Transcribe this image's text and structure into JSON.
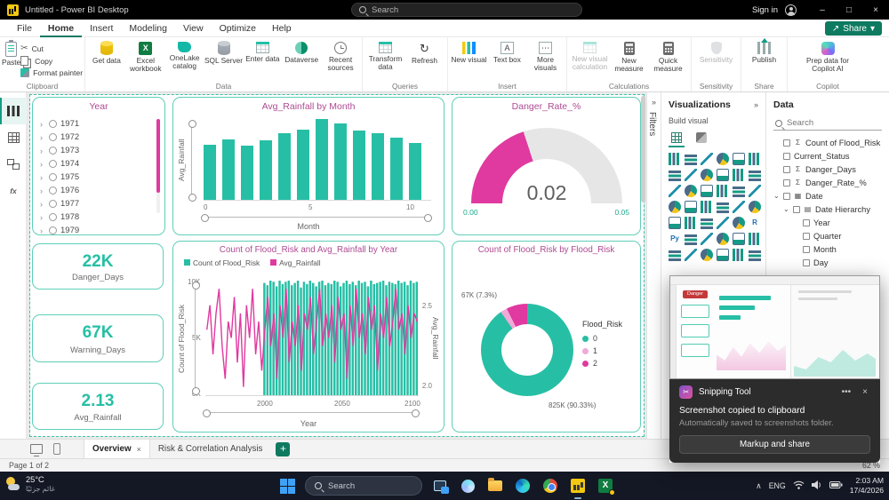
{
  "icons": {
    "minimize": "–",
    "maximize": "□",
    "close": "×",
    "share_arrow": "↗",
    "caret_down": "▾",
    "chevron_right": "›",
    "chevron_down": "⌄",
    "collapse_double": "»",
    "more": "•••",
    "plus": "+",
    "cut_glyph": "✂",
    "refresh_glyph": "↻",
    "tray_chevron": "∧",
    "text_a": "A",
    "dots": "⋯"
  },
  "colors": {
    "teal": "#26BFA5",
    "teal_dark": "#159B84",
    "pink": "#E0399F",
    "pink_light": "#F2A9D8",
    "title_pink": "#AF4B93"
  },
  "titlebar": {
    "app_title": "Untitled - Power BI Desktop",
    "search_placeholder": "Search",
    "sign_in": "Sign in"
  },
  "menubar": {
    "items": [
      "File",
      "Home",
      "Insert",
      "Modeling",
      "View",
      "Optimize",
      "Help"
    ],
    "share": "Share"
  },
  "ribbon": {
    "clipboard": {
      "label": "Clipboard",
      "paste": "Paste",
      "cut": "Cut",
      "copy": "Copy",
      "format_painter": "Format painter"
    },
    "data": {
      "label": "Data",
      "buttons": [
        "Get data",
        "Excel workbook",
        "OneLake catalog",
        "SQL Server",
        "Enter data",
        "Dataverse",
        "Recent sources"
      ]
    },
    "queries": {
      "label": "Queries",
      "buttons": [
        "Transform data",
        "Refresh"
      ]
    },
    "insert": {
      "label": "Insert",
      "buttons": [
        "New visual",
        "Text box",
        "More visuals"
      ]
    },
    "calculations": {
      "label": "Calculations",
      "buttons": [
        "New visual calculation",
        "New measure",
        "Quick measure"
      ]
    },
    "sensitivity": {
      "label": "Sensitivity",
      "buttons": [
        "Sensitivity"
      ]
    },
    "share_group": {
      "label": "Share",
      "buttons": [
        "Publish"
      ]
    },
    "copilot": {
      "label": "Copilot",
      "buttons": [
        "Prep data for Copilot AI"
      ]
    }
  },
  "canvas": {
    "slicer": {
      "title": "Year",
      "years": [
        "1971",
        "1972",
        "1973",
        "1974",
        "1975",
        "1976",
        "1977",
        "1978",
        "1979"
      ]
    },
    "bar_chart": {
      "type": "bar",
      "title": "Avg_Rainfall by Month",
      "y_label": "Avg_Rainfall",
      "x_label": "Month",
      "x_ticks": [
        "0",
        "5",
        "10"
      ],
      "months": [
        1,
        2,
        3,
        4,
        5,
        6,
        7,
        8,
        9,
        10,
        11,
        12
      ],
      "values": [
        1.75,
        1.9,
        1.72,
        1.88,
        2.1,
        2.2,
        2.55,
        2.4,
        2.18,
        2.1,
        1.95,
        1.8
      ]
    },
    "gauge": {
      "type": "gauge",
      "title": "Danger_Rate_%",
      "value": "0.02",
      "min": "0.00",
      "max": "0.05"
    },
    "cards": [
      {
        "value": "22K",
        "label": "Danger_Days"
      },
      {
        "value": "67K",
        "label": "Warning_Days"
      },
      {
        "value": "2.13",
        "label": "Avg_Rainfall"
      }
    ],
    "combo": {
      "type": "line-and-column",
      "title": "Count of Flood_Risk and Avg_Rainfall by Year",
      "legend": [
        "Count of Flood_Risk",
        "Avg_Rainfall"
      ],
      "y_left_label": "Count of Flood_Risk",
      "y_left_ticks": [
        "10K",
        "5K",
        "0K"
      ],
      "y_right_label": "Avg_Rainfall",
      "y_right_ticks": [
        "2.5",
        "2.0"
      ],
      "x_label": "Year",
      "x_ticks": [
        "2000",
        "2050",
        "2100"
      ],
      "year_start": 1962,
      "year_step": 2,
      "counts_k": [
        0,
        0,
        0,
        0,
        0,
        0,
        0,
        0,
        0,
        0,
        0,
        0,
        0,
        0,
        0,
        0,
        0,
        0,
        0,
        9.8,
        9.6,
        10,
        9.9,
        9.5,
        10,
        9.7,
        9.9,
        10,
        9.6,
        9.8,
        10,
        9.4,
        9.9,
        9.7,
        10,
        9.8,
        9.5,
        9.9,
        10,
        9.6,
        9.8,
        9.7,
        10,
        9.9,
        9.5,
        9.8,
        10,
        9.7,
        9.9,
        9.6,
        10,
        9.8,
        9.9,
        9.5,
        10,
        9.7,
        9.8,
        9.9,
        10,
        9.6,
        9.9,
        9.8,
        9.7,
        10,
        9.8,
        9.9,
        9.6,
        10,
        9.8,
        9.9
      ],
      "rainfall": [
        2.35,
        2.5,
        2.2,
        2.45,
        2.6,
        2.25,
        2.05,
        2.4,
        2.3,
        2.55,
        2.15,
        2.45,
        2.0,
        2.5,
        2.3,
        2.6,
        2.2,
        2.4,
        2.1,
        2.35,
        2.55,
        2.25,
        2.45,
        2.05,
        2.5,
        2.3,
        2.6,
        2.15,
        2.4,
        2.25,
        2.5,
        2.1,
        2.45,
        2.35,
        2.55,
        2.2,
        2.4,
        2.6,
        2.25,
        2.45,
        2.3,
        2.5,
        2.15,
        2.55,
        2.35,
        2.45,
        2.05,
        2.5,
        2.25,
        2.6,
        2.3,
        2.45,
        2.2,
        2.55,
        2.35,
        2.5,
        2.1,
        2.45,
        2.3,
        2.55,
        2.25,
        2.4,
        2.6,
        2.35,
        2.45,
        2.2,
        2.5,
        2.3,
        2.45,
        2.4
      ]
    },
    "donut": {
      "type": "donut",
      "title": "Count of Flood_Risk by Flood_Risk",
      "legend_title": "Flood_Risk",
      "slices": [
        {
          "label": "0",
          "pct": 90.33,
          "value": "825K",
          "color": "#26BFA5"
        },
        {
          "label": "1",
          "pct": 2.37,
          "value": "",
          "color": "#F2A9D8"
        },
        {
          "label": "2",
          "pct": 7.3,
          "value": "67K",
          "color": "#E0399F"
        }
      ],
      "callouts": [
        "67K (7.3%)",
        "825K (90.33%)"
      ]
    }
  },
  "filters_pane": {
    "label": "Filters"
  },
  "visualizations_pane": {
    "title": "Visualizations",
    "build_visual": "Build visual",
    "visual_types": [
      "stacked-bar-chart",
      "stacked-column-chart",
      "clustered-bar-chart",
      "clustered-column-chart",
      "100-stacked-bar-chart",
      "100-stacked-column-chart",
      "line-chart",
      "area-chart",
      "stacked-area-chart",
      "line-and-stacked-column-chart",
      "line-and-clustered-column-chart",
      "ribbon-chart",
      "waterfall-chart",
      "funnel-chart",
      "scatter-chart",
      "pie-chart",
      "donut-chart",
      "treemap",
      "map",
      "filled-map",
      "shape-map",
      "azure-map",
      "gauge",
      "card",
      "multi-row-card",
      "kpi",
      "slicer",
      "table",
      "matrix",
      "r-script-visual",
      "python-visual",
      "key-influencers",
      "decomposition-tree",
      "qa-visual",
      "smart-narrative",
      "metrics",
      "paginated-report",
      "arcgis-map",
      "power-apps",
      "power-automate",
      "text-slicer",
      "get-more-visuals"
    ]
  },
  "data_pane": {
    "title": "Data",
    "search_placeholder": "Search",
    "fields": [
      {
        "label": "Count of Flood_Risk",
        "icon": "Σ",
        "indent": 0,
        "expandable": false
      },
      {
        "label": "Current_Status",
        "icon": "",
        "indent": 0,
        "expandable": false
      },
      {
        "label": "Danger_Days",
        "icon": "Σ",
        "indent": 0,
        "expandable": false
      },
      {
        "label": "Danger_Rate_%",
        "icon": "Σ",
        "indent": 0,
        "expandable": false
      },
      {
        "label": "Date",
        "icon": "▦",
        "indent": 0,
        "expandable": true
      },
      {
        "label": "Date Hierarchy",
        "icon": "▤",
        "indent": 1,
        "expandable": true
      },
      {
        "label": "Year",
        "icon": "",
        "indent": 2,
        "expandable": false
      },
      {
        "label": "Quarter",
        "icon": "",
        "indent": 2,
        "expandable": false
      },
      {
        "label": "Month",
        "icon": "",
        "indent": 2,
        "expandable": false
      },
      {
        "label": "Day",
        "icon": "",
        "indent": 2,
        "expandable": false
      }
    ]
  },
  "tabs": {
    "overview": "Overview",
    "risk": "Risk & Correlation Analysis"
  },
  "statusbar": {
    "page_label": "Page 1 of 2",
    "zoom": "62 %"
  },
  "notification": {
    "app_name": "Snipping Tool",
    "message": "Screenshot copied to clipboard",
    "submessage": "Automatically saved to screenshots folder.",
    "action": "Markup and share",
    "thumbnail_badge": "Danger"
  },
  "taskbar": {
    "weather_temp": "25°C",
    "weather_desc": "غائم جزئيًا",
    "search_placeholder": "Search",
    "lang": "ENG",
    "time": "2:03 AM",
    "date": "17/4/2026"
  }
}
